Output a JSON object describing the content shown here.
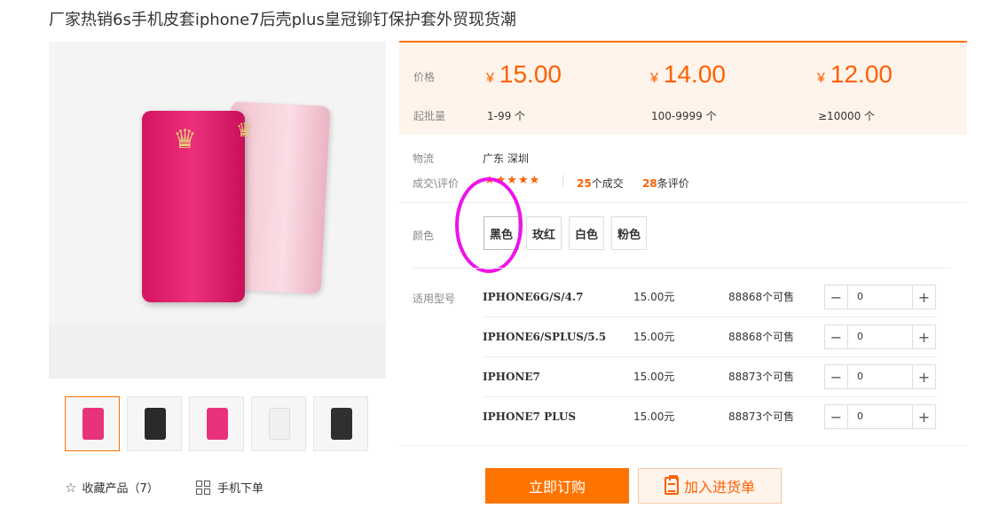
{
  "product": {
    "title": "厂家热销6s手机皮套iphone7后壳plus皇冠铆钉保护套外贸现货潮"
  },
  "pricing": {
    "price_label": "价格",
    "moq_label": "起批量",
    "currency": "¥",
    "tiers": [
      {
        "price": "15.00",
        "range": "1-99 个"
      },
      {
        "price": "14.00",
        "range": "100-9999 个"
      },
      {
        "price": "12.00",
        "range": "≥10000 个"
      }
    ]
  },
  "info": {
    "logistics_label": "物流",
    "logistics_value": "广东 深圳",
    "rating_label": "成交\\评价",
    "stars": "★★★★★",
    "deals_count": "25",
    "deals_suffix": "个成交",
    "reviews_count": "28",
    "reviews_suffix": "条评价"
  },
  "colors": {
    "label": "颜色",
    "options": [
      "黑色",
      "玫红",
      "白色",
      "粉色"
    ]
  },
  "sku": {
    "label": "适用型号",
    "rows": [
      {
        "model": "IPHONE6G/S/4.7",
        "price": "15.00元",
        "stock": "88868个可售",
        "qty": "0"
      },
      {
        "model": "IPHONE6/SPLUS/5.5",
        "price": "15.00元",
        "stock": "88868个可售",
        "qty": "0"
      },
      {
        "model": "IPHONE7",
        "price": "15.00元",
        "stock": "88873个可售",
        "qty": "0"
      },
      {
        "model": "IPHONE7 PLUS",
        "price": "15.00元",
        "stock": "88873个可售",
        "qty": "0"
      }
    ]
  },
  "actions": {
    "order": "立即订购",
    "cart": "加入进货单",
    "favorite": "收藏产品（7）",
    "mobile": "手机下单"
  },
  "thumb_colors": [
    "#e8337c",
    "#2a2a2a",
    "#e8337c",
    "#f0f0f0",
    "#303030"
  ],
  "accent": "#ff7300"
}
